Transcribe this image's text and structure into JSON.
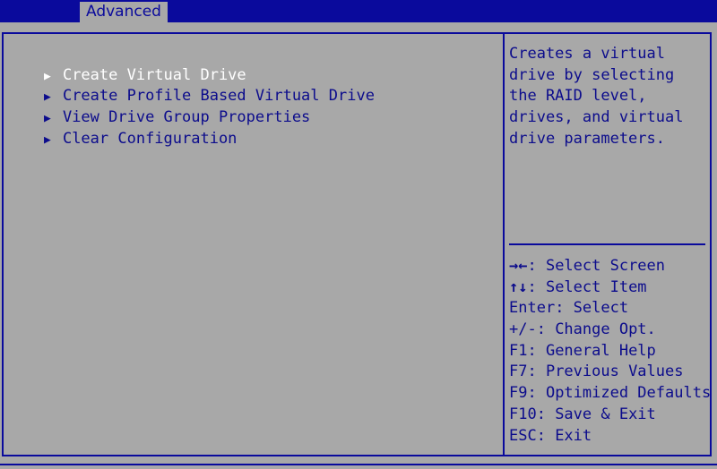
{
  "header": {
    "tab_label": "Advanced"
  },
  "menu": {
    "items": [
      {
        "label": "Create Virtual Drive",
        "selected": true
      },
      {
        "label": "Create Profile Based Virtual Drive",
        "selected": false
      },
      {
        "label": "View Drive Group Properties",
        "selected": false
      },
      {
        "label": "Clear Configuration",
        "selected": false
      }
    ],
    "arrow_glyph": "▶"
  },
  "help": {
    "text": "Creates a virtual\ndrive by selecting\nthe RAID level,\ndrives, and virtual\ndrive parameters."
  },
  "keys": [
    {
      "key": "→←",
      "desc": ": Select Screen"
    },
    {
      "key": "↑↓",
      "desc": ": Select Item"
    },
    {
      "key": "Enter",
      "desc": ": Select"
    },
    {
      "key": "+/-",
      "desc": ": Change Opt."
    },
    {
      "key": "F1",
      "desc": ": General Help"
    },
    {
      "key": "F7",
      "desc": ": Previous Values"
    },
    {
      "key": "F9",
      "desc": ": Optimized Defaults"
    },
    {
      "key": "F10",
      "desc": ": Save & Exit"
    },
    {
      "key": "ESC",
      "desc": ": Exit"
    }
  ],
  "colors": {
    "background": "#a8a8a8",
    "frame_blue": "#0a0a9c",
    "text_blue": "#0c0c8c",
    "highlight": "#ffffff"
  }
}
